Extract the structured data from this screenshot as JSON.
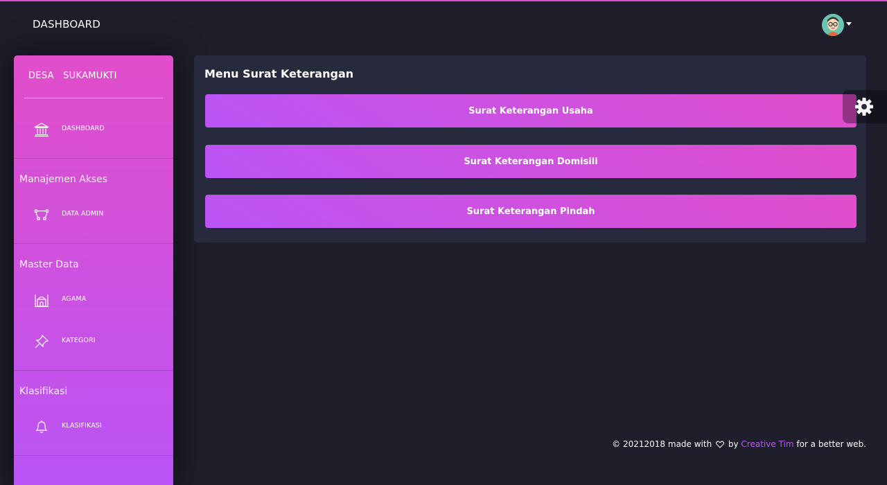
{
  "accent_color": "#e14eca",
  "secondary_accent": "#ba54f5",
  "navbar": {
    "title": "DASHBOARD",
    "avatar_icon": "user-avatar-icon",
    "dropdown_icon": "caret-down-icon"
  },
  "sidebar": {
    "logo_left": "DESA",
    "logo_right": "SUKAMUKTI",
    "items": [
      {
        "label": "DASHBOARD",
        "icon": "bank-icon"
      },
      {
        "label": "DATA ADMIN",
        "icon": "vector-nodes-icon"
      },
      {
        "label": "AGAMA",
        "icon": "mosque-icon"
      },
      {
        "label": "KATEGORI",
        "icon": "pin-icon"
      },
      {
        "label": "KLASIFIKASI",
        "icon": "bell-icon"
      }
    ],
    "sections": {
      "access": "Manajemen Akses",
      "master": "Master Data",
      "classification": "Klasifikasi"
    }
  },
  "main": {
    "title": "Menu Surat Keterangan",
    "buttons": [
      {
        "label": "Surat Keterangan Usaha"
      },
      {
        "label": "Surat Keterangan Domisili"
      },
      {
        "label": "Surat Keterangan Pindah"
      }
    ]
  },
  "settings_icon": "gear-icon",
  "footer": {
    "prefix": "© 20212018 made with",
    "by": "by",
    "link": "Creative Tim",
    "suffix": "for a better web."
  }
}
